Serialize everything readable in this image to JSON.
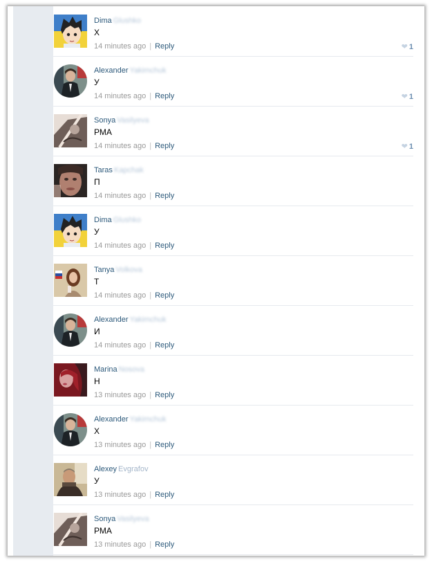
{
  "comments": [
    {
      "first": "Dima",
      "last": "Glushko",
      "last_blurred": true,
      "text": "Х",
      "time": "14 minutes ago",
      "reply": "Reply",
      "likes": "1",
      "avatar": "anime"
    },
    {
      "first": "Alexander",
      "last": "Yakimchuk",
      "last_blurred": true,
      "text": "У",
      "time": "14 minutes ago",
      "reply": "Reply",
      "likes": "1",
      "avatar": "man-round"
    },
    {
      "first": "Sonya",
      "last": "Vasilyeva",
      "last_blurred": true,
      "text": "РМА",
      "time": "14 minutes ago",
      "reply": "Reply",
      "likes": "1",
      "avatar": "sketch"
    },
    {
      "first": "Taras",
      "last": "Kapchak",
      "last_blurred": true,
      "text": "П",
      "time": "14 minutes ago",
      "reply": "Reply",
      "likes": "",
      "avatar": "face-dark"
    },
    {
      "first": "Dima",
      "last": "Glushko",
      "last_blurred": true,
      "text": "У",
      "time": "14 minutes ago",
      "reply": "Reply",
      "likes": "",
      "avatar": "anime"
    },
    {
      "first": "Tanya",
      "last": "Volkova",
      "last_blurred": true,
      "text": "Т",
      "time": "14 minutes ago",
      "reply": "Reply",
      "likes": "",
      "avatar": "girl-flag"
    },
    {
      "first": "Alexander",
      "last": "Yakimchuk",
      "last_blurred": true,
      "text": "И",
      "time": "14 minutes ago",
      "reply": "Reply",
      "likes": "",
      "avatar": "man-round"
    },
    {
      "first": "Marina",
      "last": "Nosova",
      "last_blurred": true,
      "text": "Н",
      "time": "13 minutes ago",
      "reply": "Reply",
      "likes": "",
      "avatar": "red-girl"
    },
    {
      "first": "Alexander",
      "last": "Yakimchuk",
      "last_blurred": true,
      "text": "Х",
      "time": "13 minutes ago",
      "reply": "Reply",
      "likes": "",
      "avatar": "man-round"
    },
    {
      "first": "Alexey",
      "last": "Evgrafov",
      "last_blurred": false,
      "text": "У",
      "time": "13 minutes ago",
      "reply": "Reply",
      "likes": "",
      "avatar": "old-man"
    },
    {
      "first": "Sonya",
      "last": "Vasilyeva",
      "last_blurred": true,
      "text": "РМА",
      "time": "13 minutes ago",
      "reply": "Reply",
      "likes": "",
      "avatar": "sketch"
    }
  ],
  "colors": {
    "link": "#2b587a",
    "meta": "#999999",
    "rail": "#e7ebf0"
  }
}
